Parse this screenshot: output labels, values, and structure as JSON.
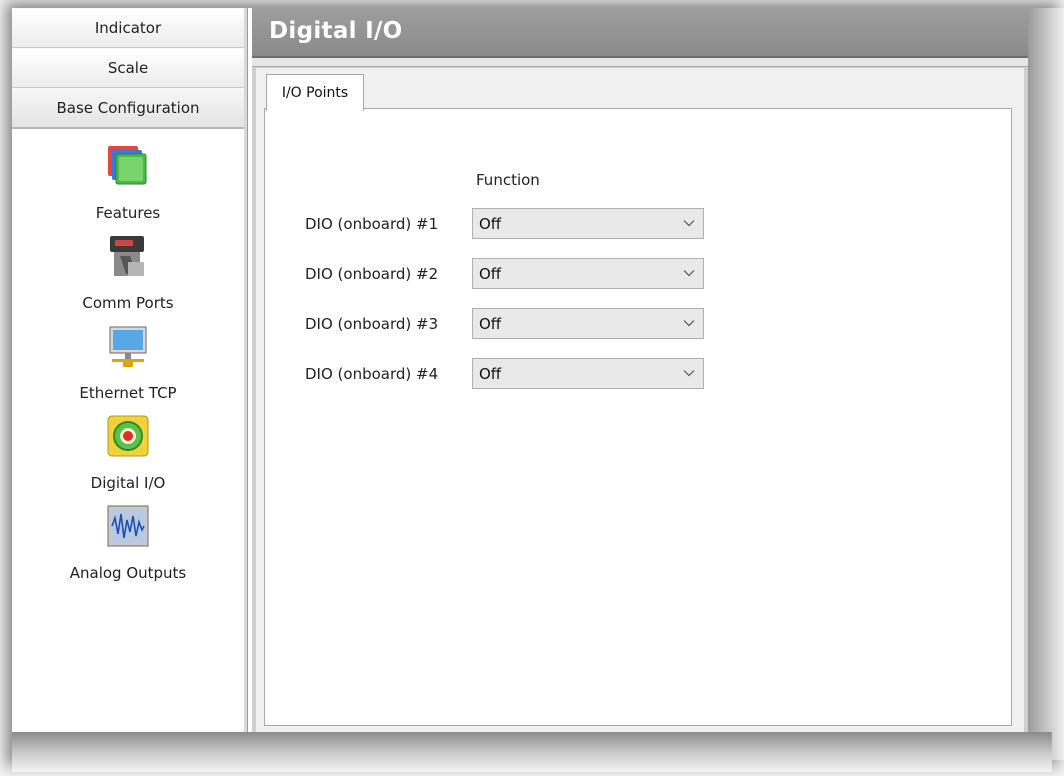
{
  "sidebar": {
    "nav_buttons": [
      {
        "label": "Indicator"
      },
      {
        "label": "Scale"
      },
      {
        "label": "Base Configuration"
      }
    ],
    "tools": [
      {
        "label": "Features",
        "icon": "features-icon"
      },
      {
        "label": "Comm Ports",
        "icon": "comm-ports-icon"
      },
      {
        "label": "Ethernet TCP",
        "icon": "ethernet-tcp-icon"
      },
      {
        "label": "Digital I/O",
        "icon": "digital-io-icon"
      },
      {
        "label": "Analog Outputs",
        "icon": "analog-outputs-icon"
      }
    ]
  },
  "main": {
    "title": "Digital I/O",
    "tabs": [
      {
        "label": "I/O Points"
      }
    ],
    "function_header": "Function",
    "rows": [
      {
        "label": "DIO (onboard) #1",
        "value": "Off"
      },
      {
        "label": "DIO (onboard) #2",
        "value": "Off"
      },
      {
        "label": "DIO (onboard) #3",
        "value": "Off"
      },
      {
        "label": "DIO (onboard) #4",
        "value": "Off"
      }
    ]
  },
  "colors": {
    "title_bar": "#8f8f8f",
    "title_text": "#ffffff",
    "select_bg": "#e9e9e9"
  }
}
